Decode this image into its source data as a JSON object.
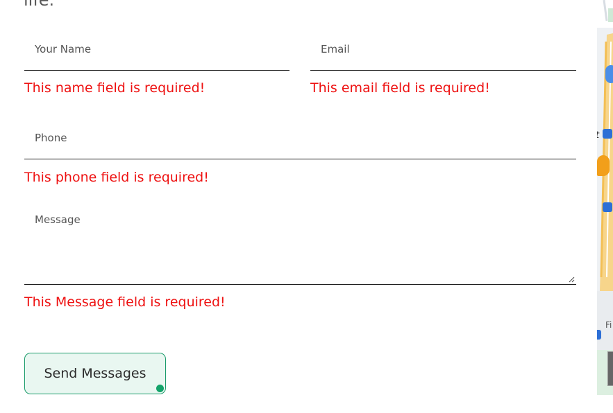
{
  "header": {
    "tail_text": "life."
  },
  "form": {
    "name": {
      "placeholder": "Your Name",
      "error": "This name field is required!"
    },
    "email": {
      "placeholder": "Email",
      "error": "This email field is required!"
    },
    "phone": {
      "placeholder": "Phone",
      "error": "This phone field is required!"
    },
    "message": {
      "placeholder": "Message",
      "error": "This Message field is required!"
    },
    "submit_label": "Send Messages"
  },
  "map": {
    "visible_text": "Fi"
  },
  "colors": {
    "error": "#ee1111",
    "button_border": "#1a9b6a",
    "button_bg": "#e9f7f1",
    "field_line": "#1e1e1e"
  }
}
